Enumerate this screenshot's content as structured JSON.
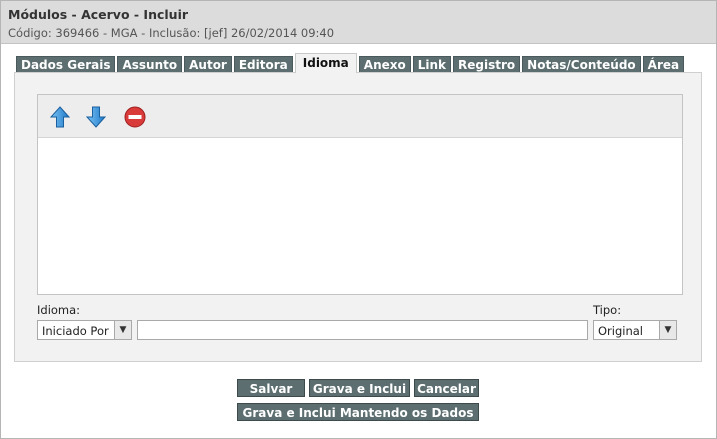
{
  "header": {
    "title": "Módulos - Acervo - Incluir",
    "subtitle": "Código: 369466 - MGA - Inclusão: [jef] 26/02/2014 09:40"
  },
  "tabs": [
    {
      "label": "Dados Gerais",
      "active": false
    },
    {
      "label": "Assunto",
      "active": false
    },
    {
      "label": "Autor",
      "active": false
    },
    {
      "label": "Editora",
      "active": false
    },
    {
      "label": "Idioma",
      "active": true
    },
    {
      "label": "Anexo",
      "active": false
    },
    {
      "label": "Link",
      "active": false
    },
    {
      "label": "Registro",
      "active": false
    },
    {
      "label": "Notas/Conteúdo",
      "active": false
    },
    {
      "label": "Área",
      "active": false
    }
  ],
  "toolbar": {
    "icons": [
      "arrow-up-icon",
      "arrow-down-icon",
      "remove-icon"
    ]
  },
  "form": {
    "idioma_label": "Idioma:",
    "idioma_select_value": "Iniciado Por",
    "idioma_text_value": "",
    "tipo_label": "Tipo:",
    "tipo_select_value": "Original"
  },
  "buttons": {
    "salvar": "Salvar",
    "grava_inclui": "Grava e Inclui",
    "cancelar": "Cancelar",
    "grava_inclui_mantendo": "Grava e Inclui Mantendo os Dados"
  },
  "colors": {
    "tab_background": "#5c6e70",
    "header_background": "#dcdcdc",
    "panel_background": "#f2f2f2"
  }
}
